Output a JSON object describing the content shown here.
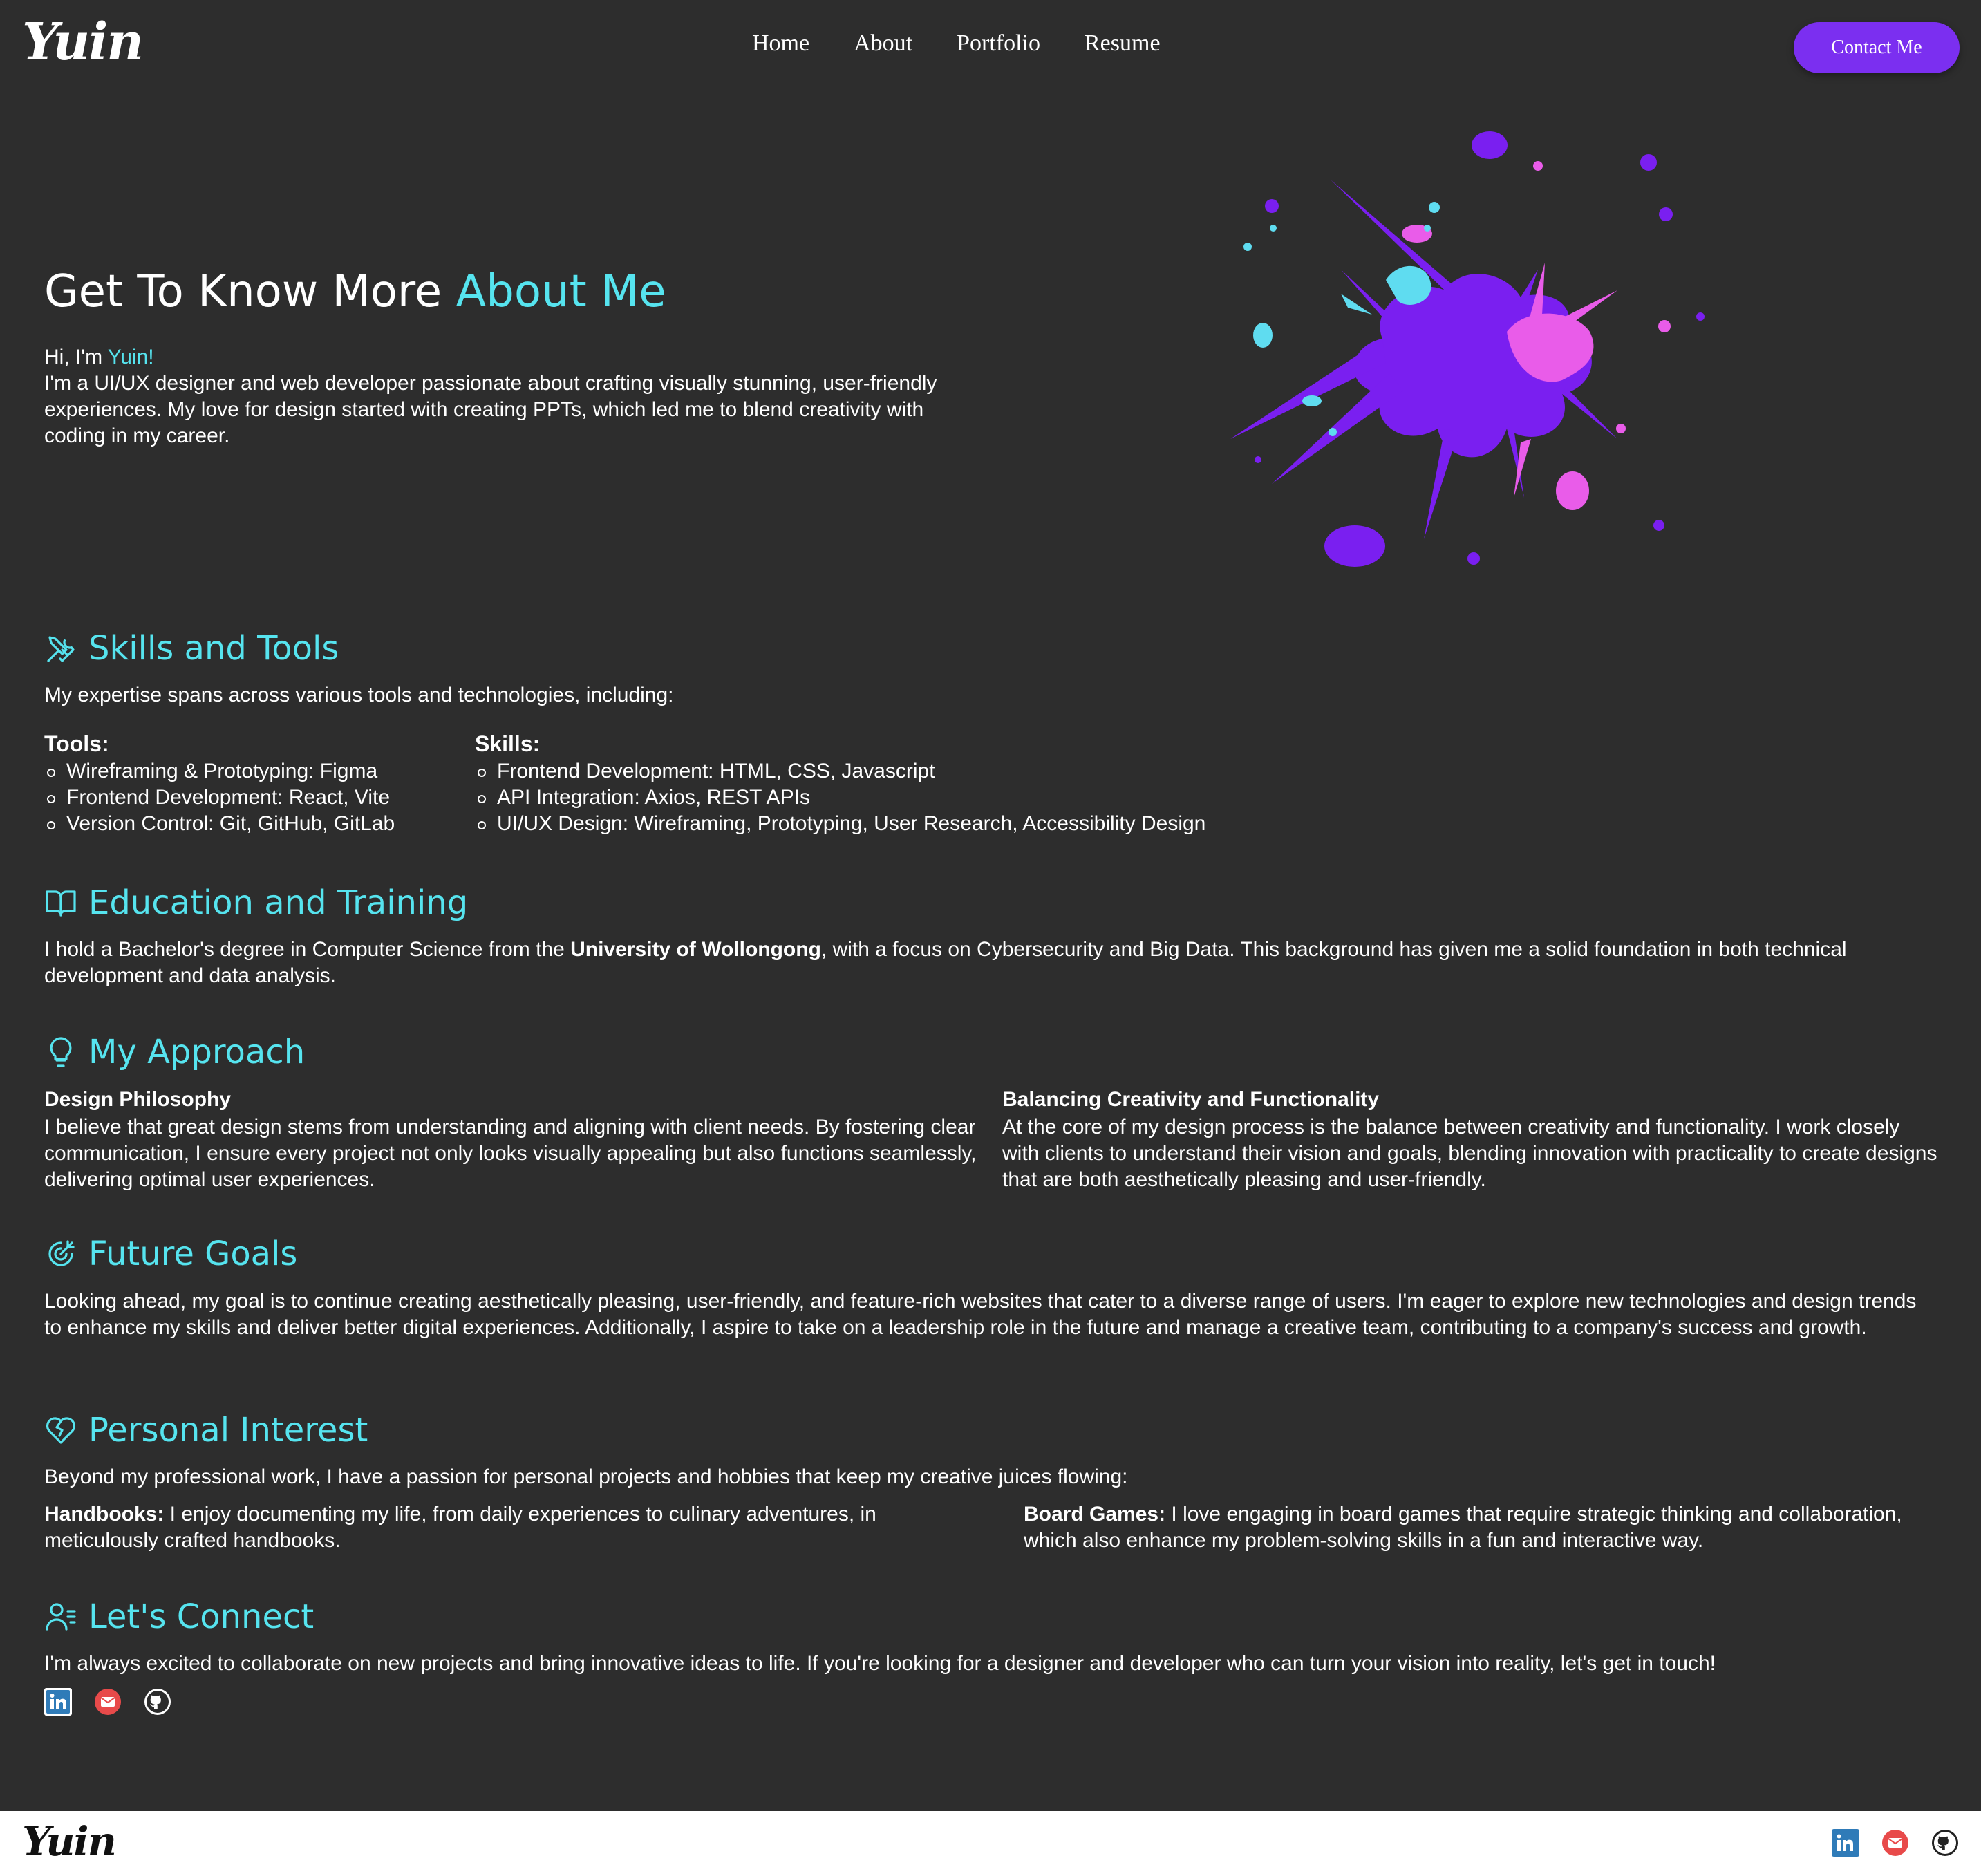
{
  "header": {
    "logo": "Yuin",
    "nav": [
      "Home",
      "About",
      "Portfolio",
      "Resume"
    ],
    "contact_label": "Contact Me"
  },
  "hero": {
    "title_prefix": "Get To Know More ",
    "title_accent": "About Me",
    "greeting_prefix": "Hi, I'm ",
    "greeting_name": "Yuin!",
    "intro": "I'm a UI/UX designer and web developer passionate about crafting visually stunning, user-friendly experiences. My love for design started with creating PPTs, which led me to blend creativity with coding in my career."
  },
  "skills": {
    "title": "Skills and Tools",
    "intro": "My expertise spans across various tools and technologies, including:",
    "tools_heading": "Tools:",
    "tools": [
      "Wireframing & Prototyping: Figma",
      "Frontend Development: React, Vite",
      "Version Control: Git, GitHub, GitLab"
    ],
    "skills_heading": "Skills:",
    "skills": [
      "Frontend Development: HTML, CSS, Javascript",
      "API Integration: Axios, REST APIs",
      "UI/UX Design: Wireframing, Prototyping, User Research, Accessibility Design"
    ]
  },
  "education": {
    "title": "Education and Training",
    "text_before": "I hold a Bachelor's degree in Computer Science from the ",
    "university": "University of Wollongong",
    "text_after": ", with a focus on Cybersecurity and Big Data. This background has given me a solid foundation in both technical development and data analysis."
  },
  "approach": {
    "title": "My Approach",
    "left_heading": "Design Philosophy",
    "left_text": "I believe that great design stems from understanding and aligning with client needs. By fostering clear communication, I ensure every project not only looks visually appealing but also functions seamlessly, delivering optimal user experiences.",
    "right_heading": "Balancing Creativity and Functionality",
    "right_text": "At the core of my design process is the balance between creativity and functionality. I work closely with clients to understand their vision and goals, blending innovation with practicality to create designs that are both aesthetically pleasing and user-friendly."
  },
  "goals": {
    "title": "Future Goals",
    "text": "Looking ahead, my goal is to continue creating aesthetically pleasing, user-friendly, and feature-rich websites that cater to a diverse range of users. I'm eager to explore new technologies and design trends to enhance my skills and deliver better digital experiences. Additionally, I aspire to take on a leadership role in the future and manage a creative team, contributing to a company's success and growth."
  },
  "interest": {
    "title": "Personal Interest",
    "intro": "Beyond my professional work, I have a passion for personal projects and hobbies that keep my creative juices flowing:",
    "left_label": "Handbooks:",
    "left_text": " I enjoy documenting my life, from daily experiences to culinary adventures, in meticulously crafted handbooks.",
    "right_label": "Board Games:",
    "right_text": " I love engaging in board games that require strategic thinking and collaboration, which also enhance my problem-solving skills in a fun and interactive way."
  },
  "connect": {
    "title": "Let's Connect",
    "text": "I'm always excited to collaborate on new projects and bring innovative ideas to life. If you're looking for a designer and developer who can turn your vision into reality, let's get in touch!",
    "icons": [
      "linkedin-icon",
      "email-icon",
      "github-icon"
    ]
  },
  "footer": {
    "logo": "Yuin"
  },
  "colors": {
    "background": "#2d2d2d",
    "accent": "#56e4ef",
    "button": "#7b2ff0",
    "splash_main": "#7a1ff0",
    "splash_pink": "#e95ce9",
    "splash_cyan": "#5fdcf0"
  }
}
